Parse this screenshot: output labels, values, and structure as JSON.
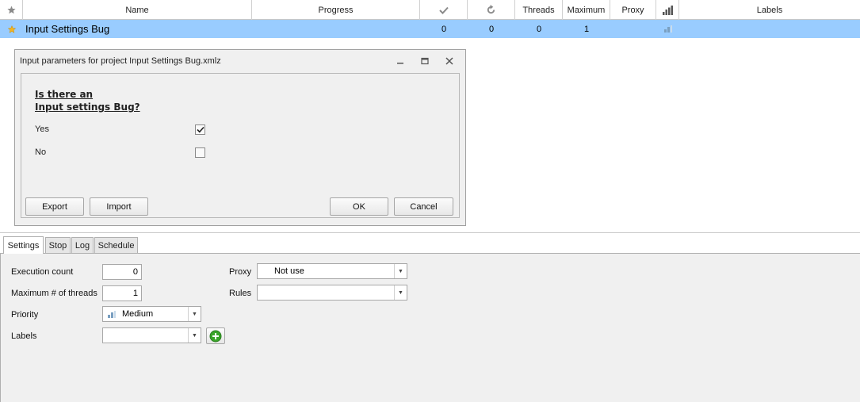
{
  "grid": {
    "headers": {
      "star_icon": "star-icon",
      "name": "Name",
      "progress": "Progress",
      "check_icon": "checkmark-icon",
      "refresh_icon": "refresh-icon",
      "threads": "Threads",
      "maximum": "Maximum",
      "proxy": "Proxy",
      "priority_icon": "signal-bars-icon",
      "labels": "Labels"
    },
    "row": {
      "name": "Input Settings Bug",
      "success": "0",
      "repeats": "0",
      "threads": "0",
      "maximum": "1"
    }
  },
  "dialog": {
    "title": "Input parameters for project Input Settings Bug.xmlz",
    "question_line1": "Is there an",
    "question_line2": "Input settings Bug?",
    "options": [
      {
        "label": "Yes",
        "checked": true
      },
      {
        "label": "No",
        "checked": false
      }
    ],
    "buttons": {
      "export": "Export",
      "import": "Import",
      "ok": "OK",
      "cancel": "Cancel"
    }
  },
  "tabs": [
    "Settings",
    "Stop",
    "Log",
    "Schedule"
  ],
  "settings": {
    "execution_count_label": "Execution count",
    "execution_count_value": "0",
    "max_threads_label": "Maximum # of threads",
    "max_threads_value": "1",
    "priority_label": "Priority",
    "priority_value": "Medium",
    "labels_label": "Labels",
    "labels_value": "",
    "proxy_label": "Proxy",
    "proxy_value": "Not use",
    "rules_label": "Rules",
    "rules_value": ""
  },
  "colors": {
    "selected_row": "#99ccff",
    "panel_bg": "#f0f0f0",
    "star": "#f3b421",
    "add_green": "#3aa52a"
  }
}
